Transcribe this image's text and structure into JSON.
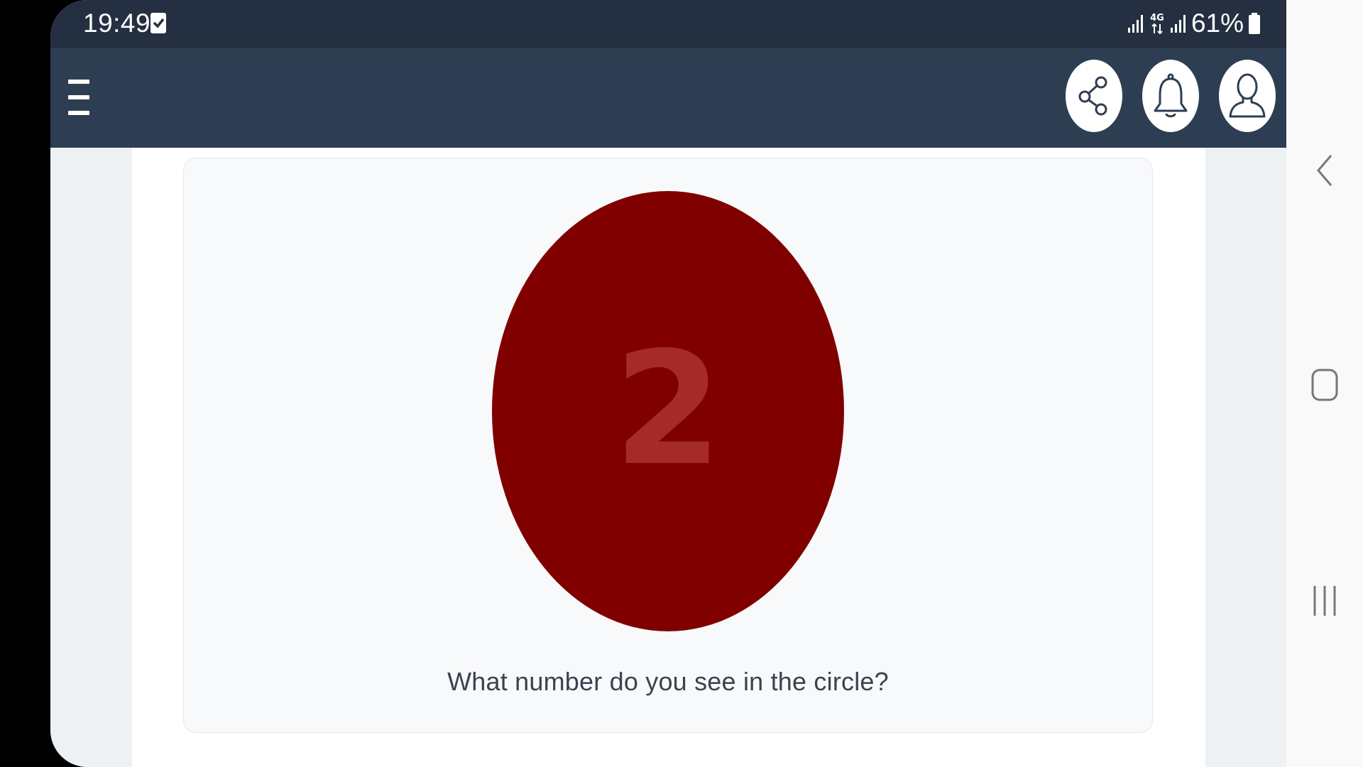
{
  "status_bar": {
    "time": "19:49",
    "battery": "61%",
    "network": "4G",
    "icons": [
      "check-notification-icon",
      "signal-icon",
      "4g-icon",
      "signal-icon",
      "battery-icon"
    ]
  },
  "app_bar": {
    "menu_icon": "hamburger-menu-icon",
    "actions": [
      {
        "name": "share",
        "icon": "share-icon"
      },
      {
        "name": "notifications",
        "icon": "bell-icon"
      },
      {
        "name": "profile",
        "icon": "user-icon"
      }
    ]
  },
  "test": {
    "plate_number": "2",
    "question": "What number do you see in the circle?",
    "plate_color": "#800000",
    "number_color": "#a52a2a"
  },
  "colors": {
    "status_bar": "#243041",
    "app_bar": "#2e3e52",
    "background": "#eef1f4",
    "card": "#f8f9fb"
  },
  "nav_bar": {
    "buttons": [
      {
        "name": "back",
        "icon": "chevron-left-icon"
      },
      {
        "name": "home",
        "icon": "home-square-icon"
      },
      {
        "name": "recents",
        "icon": "recents-icon"
      }
    ]
  }
}
